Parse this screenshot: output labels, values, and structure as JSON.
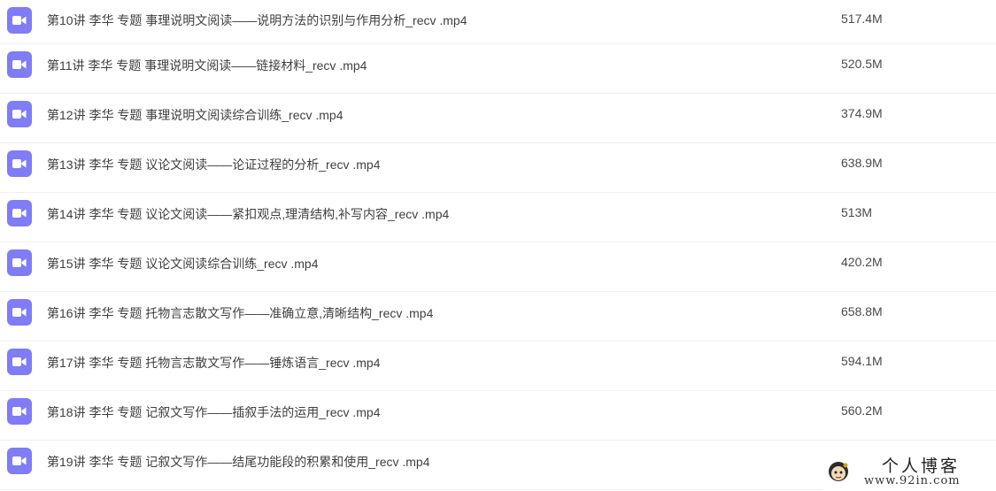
{
  "files": [
    {
      "name": "第10讲 李华 专题 事理说明文阅读——说明方法的识别与作用分析_recv .mp4",
      "size": "517.4M",
      "icon": "video-file-icon"
    },
    {
      "name": "第11讲 李华 专题 事理说明文阅读——链接材料_recv .mp4",
      "size": "520.5M",
      "icon": "video-file-icon"
    },
    {
      "name": "第12讲 李华 专题 事理说明文阅读综合训练_recv .mp4",
      "size": "374.9M",
      "icon": "video-file-icon"
    },
    {
      "name": "第13讲 李华 专题 议论文阅读——论证过程的分析_recv .mp4",
      "size": "638.9M",
      "icon": "video-file-icon"
    },
    {
      "name": "第14讲 李华 专题 议论文阅读——紧扣观点,理清结构,补写内容_recv .mp4",
      "size": "513M",
      "icon": "video-file-icon"
    },
    {
      "name": "第15讲 李华 专题 议论文阅读综合训练_recv .mp4",
      "size": "420.2M",
      "icon": "video-file-icon"
    },
    {
      "name": "第16讲 李华 专题 托物言志散文写作——准确立意,清晰结构_recv .mp4",
      "size": "658.8M",
      "icon": "video-file-icon"
    },
    {
      "name": "第17讲 李华 专题 托物言志散文写作——锤炼语言_recv .mp4",
      "size": "594.1M",
      "icon": "video-file-icon"
    },
    {
      "name": "第18讲 李华 专题 记叙文写作——插叙手法的运用_recv .mp4",
      "size": "560.2M",
      "icon": "video-file-icon"
    },
    {
      "name": "第19讲 李华 专题 记叙文写作——结尾功能段的积累和使用_recv .mp4",
      "size": "",
      "icon": "video-file-icon"
    }
  ],
  "watermark": {
    "title": "个人博客",
    "url": "www.92in.com"
  },
  "colors": {
    "icon_bg": "#7f7cf6",
    "text": "#3f3f3f",
    "divider": "#f0f0f2"
  }
}
